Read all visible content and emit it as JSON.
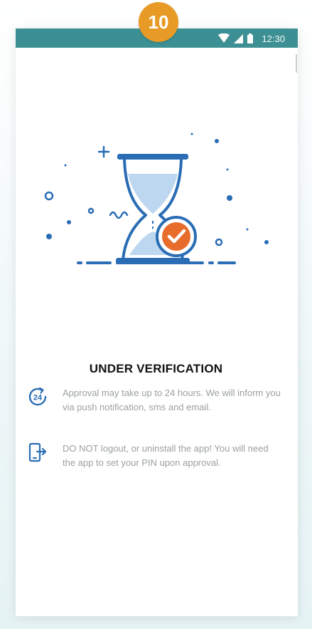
{
  "step_badge": {
    "label": "10",
    "color": "#e79a25"
  },
  "status_bar": {
    "time": "12:30",
    "color": "#3c8f93",
    "icons": [
      "wifi-icon",
      "signal-icon",
      "battery-icon"
    ]
  },
  "illustration": {
    "icon": "hourglass-with-check-icon",
    "primary_color": "#2a6db5",
    "accent_color": "#e86c2c"
  },
  "main": {
    "title": "UNDER VERIFICATION",
    "info": [
      {
        "icon": "24-hours-icon",
        "text": "Approval may take up to 24 hours. We will inform you via push notification, sms and email."
      },
      {
        "icon": "device-exit-icon",
        "text": "DO NOT logout, or uninstall the app! You will need the app to set your PIN upon approval."
      }
    ]
  }
}
